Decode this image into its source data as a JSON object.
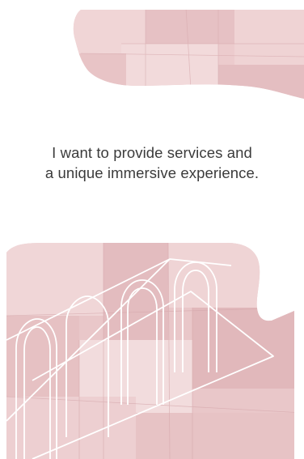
{
  "tagline": {
    "line1": "I want to provide services and",
    "line2": "a unique immersive experience."
  },
  "colors": {
    "background": "#ffffff",
    "fabric_pink": "#e9c7c9",
    "fabric_light": "#f1d9da",
    "fabric_dark": "#dcb3b6",
    "text": "#3b3b3b",
    "lines": "#ffffff"
  }
}
